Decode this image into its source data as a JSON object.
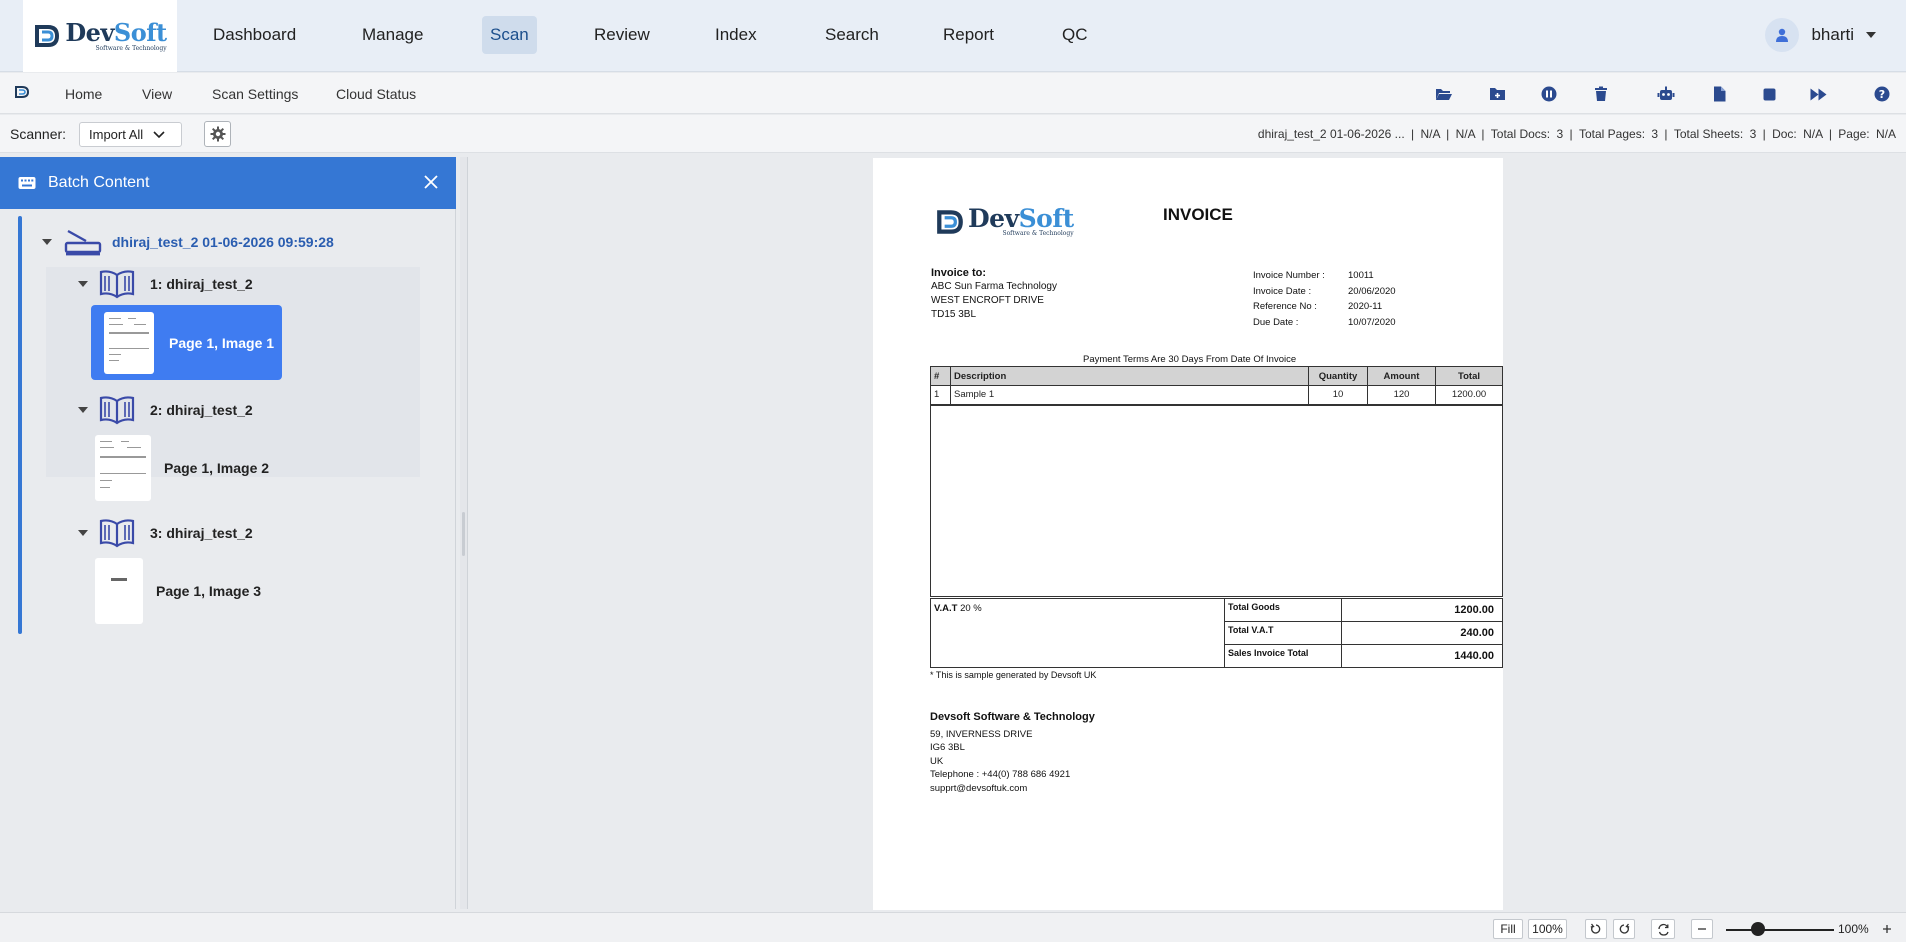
{
  "brand": {
    "word_dev": "Dev",
    "word_soft": "Soft",
    "tagline": "Software & Technology"
  },
  "nav": {
    "items": [
      "Dashboard",
      "Manage",
      "Scan",
      "Review",
      "Index",
      "Search",
      "Report",
      "QC"
    ],
    "active": "Scan"
  },
  "user": {
    "name": "bharti"
  },
  "menu": {
    "items": [
      "Home",
      "View",
      "Scan Settings",
      "Cloud Status"
    ]
  },
  "toolbar": {
    "icons": [
      "folder-open-icon",
      "folder-add-icon",
      "pause-icon",
      "trash-icon",
      "robot-icon",
      "document-icon",
      "stop-icon",
      "fast-forward-icon",
      "help-icon"
    ]
  },
  "scanner": {
    "label": "Scanner:",
    "selected": "Import All"
  },
  "status": {
    "batch": "dhiraj_test_2 01-06-2026 ...",
    "sep": "|",
    "v1": "N/A",
    "v2": "N/A",
    "total_docs_label": "Total Docs:",
    "total_docs": "3",
    "total_pages_label": "Total Pages:",
    "total_pages": "3",
    "total_sheets_label": "Total Sheets:",
    "total_sheets": "3",
    "doc_label": "Doc:",
    "doc": "N/A",
    "page_label": "Page:",
    "page": "N/A"
  },
  "panel": {
    "title": "Batch Content",
    "batch_name": "dhiraj_test_2 01-06-2026 09:59:28",
    "documents": [
      {
        "label": "1: dhiraj_test_2",
        "page": "Page 1, Image 1"
      },
      {
        "label": "2: dhiraj_test_2",
        "page": "Page 1, Image 2"
      },
      {
        "label": "3: dhiraj_test_2",
        "page": "Page 1, Image 3"
      }
    ]
  },
  "invoice": {
    "title": "INVOICE",
    "to_label": "Invoice to:",
    "to_lines": [
      "ABC Sun Farma Technology",
      "WEST ENCROFT DRIVE",
      "TD15 3BL"
    ],
    "meta": [
      {
        "k": "Invoice Number :",
        "v": "10011"
      },
      {
        "k": "Invoice Date :",
        "v": "20/06/2020"
      },
      {
        "k": "Reference No :",
        "v": "2020-11"
      },
      {
        "k": "Due Date :",
        "v": "10/07/2020"
      }
    ],
    "terms": "Payment Terms Are 30 Days From Date Of Invoice",
    "columns": [
      "#",
      "Description",
      "Quantity",
      "Amount",
      "Total"
    ],
    "row": [
      "1",
      "Sample 1",
      "10",
      "120",
      "1200.00"
    ],
    "vat_label": "V.A.T",
    "vat_rate": "20 %",
    "totals": [
      {
        "k": "Total Goods",
        "v": "1200.00"
      },
      {
        "k": "Total V.A.T",
        "v": "240.00"
      },
      {
        "k": "Sales Invoice Total",
        "v": "1440.00"
      }
    ],
    "note": "* This is sample generated by Devsoft UK",
    "company": "Devsoft Software & Technology",
    "address": [
      "59, INVERNESS DRIVE",
      "IG6 3BL",
      "UK",
      "Telephone : +44(0) 788 686 4921",
      "supprt@devsoftuk.com"
    ]
  },
  "statusbar": {
    "fill": "Fill",
    "zoom_btn": "100%",
    "zoom": "100%",
    "zoom_level": 0.3
  }
}
